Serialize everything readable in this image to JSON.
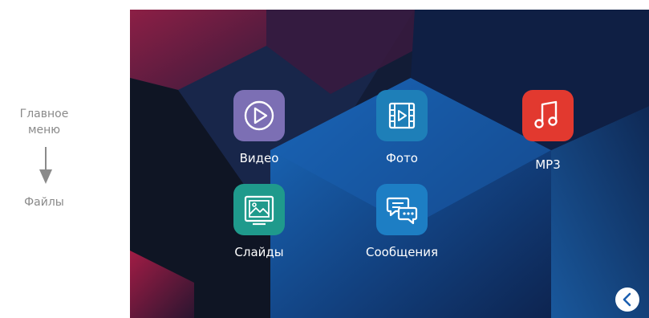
{
  "sidebar": {
    "main_label": "Главное\nменю",
    "files_label": "Файлы"
  },
  "apps": [
    {
      "label": "Видео",
      "color": "#7c6fb4",
      "icon": "play-icon"
    },
    {
      "label": "Фото",
      "color": "#1e7fb8",
      "icon": "film-icon"
    },
    {
      "label": "MP3",
      "color": "#e2392f",
      "icon": "music-note-icon"
    },
    {
      "label": "Слайды",
      "color": "#1f9a8c",
      "icon": "picture-icon"
    },
    {
      "label": "Сообщения",
      "color": "#1d7ec4",
      "icon": "chat-icon"
    }
  ],
  "back_button": {
    "icon": "chevron-left-icon"
  }
}
